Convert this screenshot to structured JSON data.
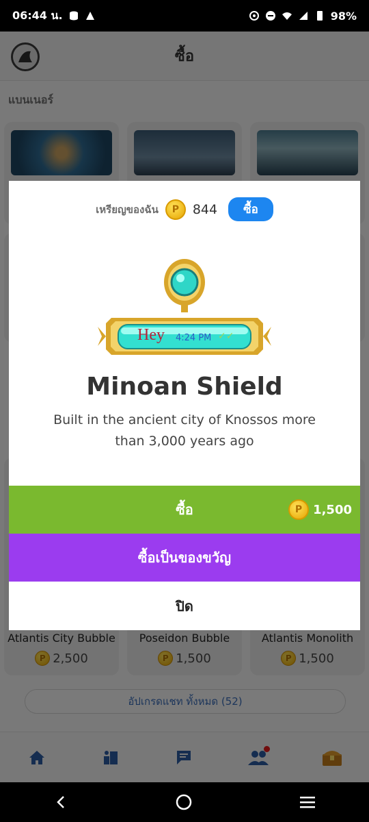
{
  "status_bar": {
    "time": "06:44 น.",
    "battery": "98%",
    "icons": [
      "data-saver-icon",
      "cast-icon",
      "alarm-icon",
      "dnd-icon",
      "wifi-icon",
      "signal-icon",
      "battery-icon"
    ]
  },
  "header": {
    "title": "ซื้อ"
  },
  "section": {
    "banners_label": "แบนเนอร์"
  },
  "bubbles_row": {
    "items": [
      {
        "name": "Atlantis City Bubble",
        "price": "2,500"
      },
      {
        "name": "Poseidon Bubble",
        "price": "1,500"
      },
      {
        "name": "Atlantis Monolith",
        "price": "1,500"
      }
    ]
  },
  "upgrade_link": "อัปเกรดแชท ทั้งหมด (52)",
  "tabs": [
    "home-icon",
    "store-apps-icon",
    "chat-icon",
    "friends-icon",
    "treasure-chest-icon"
  ],
  "modal": {
    "my_coins_label": "เหรียญของฉัน",
    "my_coins_value": "844",
    "buy_small_label": "ซื้อ",
    "preview_text": "Hey",
    "preview_time": "4:24 PM",
    "preview_check": "✓✓",
    "item_title": "Minoan Shield",
    "item_description": "Built in the ancient city of Knossos more than 3,000 years ago",
    "buy_label": "ซื้อ",
    "buy_price": "1,500",
    "gift_label": "ซื้อเป็นของขวัญ",
    "close_label": "ปิด"
  },
  "colors": {
    "buy_green": "#7ab92f",
    "gift_purple": "#9b3cef",
    "coins_buy_blue": "#1d86f0"
  }
}
